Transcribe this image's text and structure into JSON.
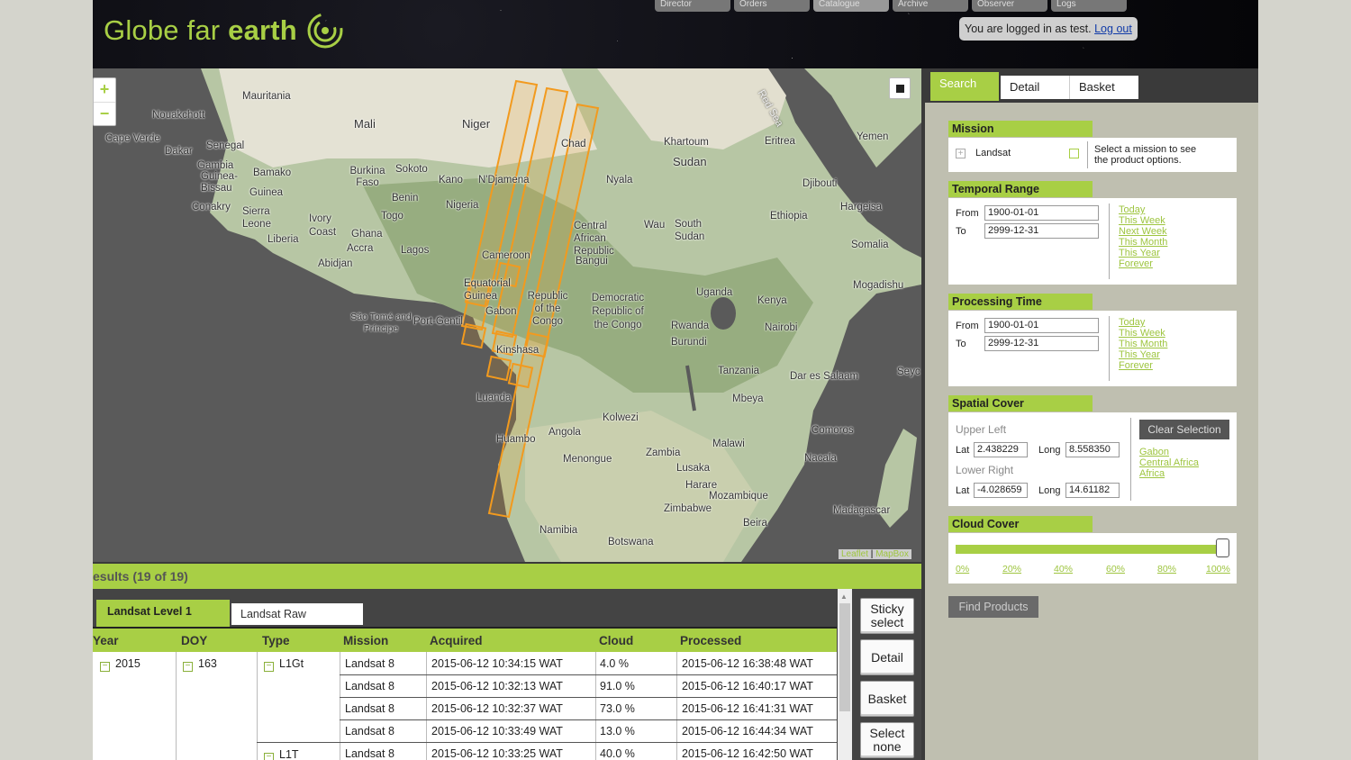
{
  "header": {
    "logo_light": "Globe far ",
    "logo_bold": "earth",
    "nav": [
      "Director",
      "Orders",
      "Catalogue",
      "Archive",
      "Observer",
      "Logs"
    ],
    "login_text": "You are logged in as test.",
    "logout_label": "Log out"
  },
  "map": {
    "zoom_in": "+",
    "zoom_out": "−",
    "attribution_leaflet": "Leaflet",
    "attribution_sep": " | ",
    "attribution_mapbox": "MapBox",
    "labels": {
      "mauritania": "Mauritania",
      "mali": "Mali",
      "niger": "Niger",
      "chad": "Chad",
      "sudan": "Sudan",
      "yemen": "Yemen",
      "red_sea": "Red Sea",
      "nouakchott": "Nouakchott",
      "cape_verde": "Cape Verde",
      "dakar": "Dakar",
      "senegal": "Senegal",
      "gambia": "Gambia",
      "guinea_bissau": "Guinea-Bissau",
      "bamako": "Bamako",
      "burkina_faso": "Burkina Faso",
      "sokoto": "Sokoto",
      "kano": "Kano",
      "ndjamena": "N'Djamena",
      "khartoum": "Khartoum",
      "eritrea": "Eritrea",
      "djibouti": "Djibouti",
      "hargeisa": "Hargeisa",
      "guinea": "Guinea",
      "conakry": "Conakry",
      "sierra_leone": "Sierra Leone",
      "liberia": "Liberia",
      "ivory_coast": "Ivory Coast",
      "ghana": "Ghana",
      "accra": "Accra",
      "abidjan": "Abidjan",
      "benin": "Benin",
      "togo": "Togo",
      "lagos": "Lagos",
      "nigeria": "Nigeria",
      "nyala": "Nyala",
      "car": "Central African Republic",
      "bangui": "Bangui",
      "wau": "Wau",
      "south_sudan": "South Sudan",
      "ethiopia": "Ethiopia",
      "somalia": "Somalia",
      "cameroon": "Cameroon",
      "eq_guinea": "Equatorial Guinea",
      "gabon": "Gabon",
      "rep_congo": "Republic of the Congo",
      "drc": "Democratic Republic of the Congo",
      "uganda": "Uganda",
      "kenya": "Kenya",
      "mogadishu": "Mogadishu",
      "sao_tome": "São Tomé and Príncipe",
      "port_gentil": "Port-Gentil",
      "rwanda": "Rwanda",
      "burundi": "Burundi",
      "nairobi": "Nairobi",
      "kinshasa": "Kinshasa",
      "tanzania": "Tanzania",
      "dar_es_salaam": "Dar es Salaam",
      "seychelles": "Seyc",
      "luanda": "Luanda",
      "mbeya": "Mbeya",
      "kolwezi": "Kolwezi",
      "angola": "Angola",
      "huambo": "Huambo",
      "comoros": "Comoros",
      "malawi": "Malawi",
      "zambia": "Zambia",
      "menongue": "Menongue",
      "lusaka": "Lusaka",
      "nacala": "Nacala",
      "harare": "Harare",
      "mozambique": "Mozambique",
      "zimbabwe": "Zimbabwe",
      "madagascar": "Madagascar",
      "beira": "Beira",
      "namibia": "Namibia",
      "botswana": "Botswana"
    }
  },
  "panel": {
    "tabs": [
      "Search",
      "Detail",
      "Basket"
    ],
    "mission": {
      "title": "Mission",
      "item": "Landsat",
      "hint": "Select a mission to see the product options."
    },
    "temporal": {
      "title": "Temporal Range",
      "from_label": "From",
      "from_value": "1900-01-01",
      "to_label": "To",
      "to_value": "2999-12-31",
      "quick": [
        "Today",
        "This Week",
        "Next Week",
        "This Month",
        "This Year",
        "Forever"
      ]
    },
    "processing": {
      "title": "Processing Time",
      "from_label": "From",
      "from_value": "1900-01-01",
      "to_label": "To",
      "to_value": "2999-12-31",
      "quick": [
        "Today",
        "This Week",
        "This Month",
        "This Year",
        "Forever"
      ]
    },
    "spatial": {
      "title": "Spatial Cover",
      "upper_left": "Upper Left",
      "lower_right": "Lower Right",
      "lat_label": "Lat",
      "long_label": "Long",
      "ul_lat": "2.438229",
      "ul_long": "8.558350",
      "lr_lat": "-4.028659",
      "lr_long": "14.61182",
      "clear_label": "Clear Selection",
      "regions": [
        "Gabon",
        "Central Africa",
        "Africa"
      ]
    },
    "cloud": {
      "title": "Cloud Cover",
      "value_percent": 100,
      "ticks": [
        "0%",
        "20%",
        "40%",
        "60%",
        "80%",
        "100%"
      ]
    },
    "find_label": "Find Products"
  },
  "results": {
    "title": "esults (19 of 19)",
    "tabs": [
      "Landsat Level 1",
      "Landsat Raw"
    ],
    "columns": [
      "Year",
      "DOY",
      "Type",
      "Mission",
      "Acquired",
      "Cloud",
      "Processed"
    ],
    "group": {
      "year": "2015",
      "doy": "163",
      "type1": "L1Gt",
      "type2": "L1T"
    },
    "rows": [
      {
        "mission": "Landsat 8",
        "acquired": "2015-06-12 10:34:15 WAT",
        "cloud": "4.0 %",
        "processed": "2015-06-12 16:38:48 WAT"
      },
      {
        "mission": "Landsat 8",
        "acquired": "2015-06-12 10:32:13 WAT",
        "cloud": "91.0 %",
        "processed": "2015-06-12 16:40:17 WAT"
      },
      {
        "mission": "Landsat 8",
        "acquired": "2015-06-12 10:32:37 WAT",
        "cloud": "73.0 %",
        "processed": "2015-06-12 16:41:31 WAT"
      },
      {
        "mission": "Landsat 8",
        "acquired": "2015-06-12 10:33:49 WAT",
        "cloud": "13.0 %",
        "processed": "2015-06-12 16:44:34 WAT"
      },
      {
        "mission": "Landsat 8",
        "acquired": "2015-06-12 10:33:25 WAT",
        "cloud": "40.0 %",
        "processed": "2015-06-12 16:42:50 WAT"
      }
    ],
    "buttons": {
      "sticky": "Sticky select",
      "detail": "Detail",
      "basket": "Basket",
      "select_none": "Select none"
    }
  }
}
